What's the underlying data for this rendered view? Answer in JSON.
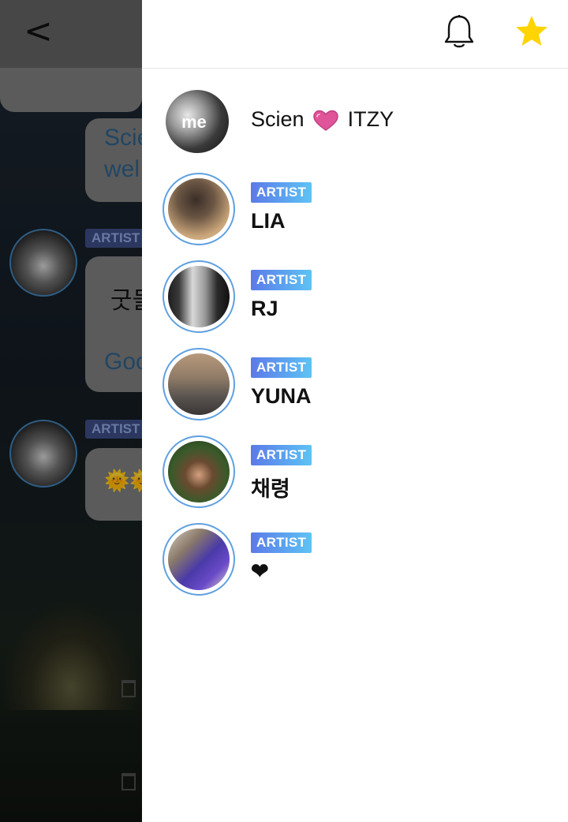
{
  "background": {
    "back_icon": "chevron-left-icon",
    "card_texts": [
      "Scie",
      "wel",
      "굿들",
      "Goo",
      "🌞🌞"
    ],
    "badges": [
      "ARTIST",
      "ARTIST"
    ]
  },
  "header": {
    "bell_icon": "bell-icon",
    "star_icon": "star-icon",
    "star_color": "#FFD400"
  },
  "me": {
    "avatar_label": "me",
    "name_left": "Scien",
    "name_right": "ITZY",
    "heart_color": "#E0559A"
  },
  "members": [
    {
      "badge": "ARTIST",
      "name": "LIA"
    },
    {
      "badge": "ARTIST",
      "name": "RJ"
    },
    {
      "badge": "ARTIST",
      "name": "YUNA"
    },
    {
      "badge": "ARTIST",
      "name": "채령"
    },
    {
      "badge": "ARTIST",
      "name": "❤"
    }
  ],
  "colors": {
    "badge_start": "#5b7ae8",
    "badge_end": "#5dc3f5",
    "ring": "#5fa0e0"
  }
}
